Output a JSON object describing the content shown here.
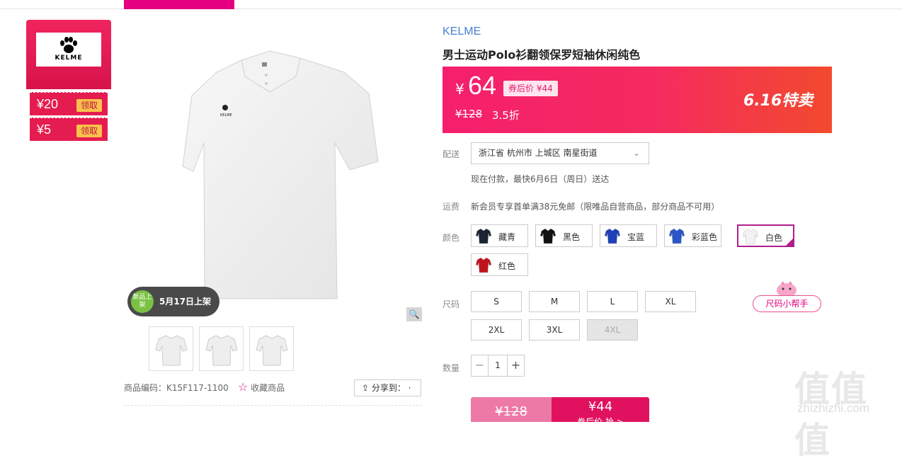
{
  "brand_card": {
    "logo_text": "KELME"
  },
  "coupons": [
    {
      "amount": "¥20",
      "action": "领取"
    },
    {
      "amount": "¥5",
      "action": "领取"
    }
  ],
  "gallery": {
    "new_badge": "新品上架",
    "launch_date": "5月17日上架"
  },
  "product_code": "商品编码：K15F117-1100",
  "favorite": "收藏商品",
  "share": "分享到：",
  "product": {
    "brand": "KELME",
    "title": "男士运动Polo衫翻领保罗短袖休闲纯色"
  },
  "price": {
    "currency": "¥",
    "current": "64",
    "after_coupon": "券后价 ¥44",
    "original": "¥128",
    "discount": "3.5折",
    "promo": "6.16特卖"
  },
  "delivery": {
    "label": "配送",
    "address": "浙江省 杭州市 上城区 南星街道",
    "eta": "现在付款，最快6月6日（周日）送达"
  },
  "shipping": {
    "label": "运费",
    "text": "新会员专享首单满38元免邮（限唯品自营商品，部分商品不可用）"
  },
  "colors": {
    "label": "颜色",
    "options": [
      {
        "name": "藏青",
        "color": "#1c2333"
      },
      {
        "name": "黑色",
        "color": "#111111"
      },
      {
        "name": "宝蓝",
        "color": "#1f3fb8"
      },
      {
        "name": "彩蓝色",
        "color": "#2b55c6"
      },
      {
        "name": "白色",
        "color": "#f2f2f2",
        "selected": true
      },
      {
        "name": "红色",
        "color": "#c0141c"
      }
    ]
  },
  "sizes": {
    "label": "尺码",
    "options": [
      "S",
      "M",
      "L",
      "XL",
      "2XL",
      "3XL",
      "4XL"
    ],
    "unavailable": [
      "4XL"
    ],
    "helper": "尺码小帮手"
  },
  "quantity": {
    "label": "数量",
    "value": "1"
  },
  "buy": {
    "original": "¥128",
    "price": "¥44",
    "action": "券后价 抢 >"
  },
  "watermark": {
    "glyphs": "值值值",
    "site": "zhizhizhi.com"
  },
  "accent_colors": {
    "brand_pink": "#e4007f",
    "price_red": "#f51f6d"
  }
}
